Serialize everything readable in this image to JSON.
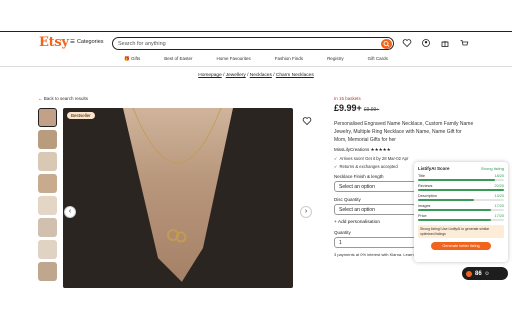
{
  "header": {
    "logo": "Etsy",
    "categories_label": "Categories",
    "search_placeholder": "Search for anything"
  },
  "nav": [
    "Gifts",
    "Best of Easter",
    "Home Favourites",
    "Fashion Finds",
    "Registry",
    "Gift Cards"
  ],
  "breadcrumb": [
    "Homepage",
    "Jewellery",
    "Necklaces",
    "Charm Necklaces"
  ],
  "back_link": "Back to search results",
  "main_image": {
    "badge": "Bestseller"
  },
  "listing": {
    "in_baskets": "In 15 baskets",
    "price": "£9.99+",
    "old_price": "£9.99+",
    "title": "Personalised Engraved Name Necklace, Custom Family Name Jewelry, Multiple Ring Necklace with Name, Name Gift for Mom, Memorial Gifts for her",
    "shop": "MissLilyCreations",
    "stars": "★★★★★",
    "arrives": "Arrives soon! Get it by 28 Mar-02 Apr",
    "returns": "Returns & exchanges accepted",
    "finish_label": "Necklace Finish & length",
    "finish_value": "Select an option",
    "disc_label": "Disc Quantity",
    "disc_value": "Select an option",
    "add_personalisation": "+ Add personalisation",
    "quantity_label": "Quantity",
    "quantity_value": "1",
    "klarna": "3 payments at 0% interest with Klarna. Learn more"
  },
  "panel": {
    "title": "ListifyAI Score",
    "level": "Strong listing",
    "metrics": [
      {
        "name": "Title",
        "score": "18/20",
        "fill": 0.9
      },
      {
        "name": "Reviews",
        "score": "20/20",
        "fill": 1.0
      },
      {
        "name": "Description",
        "score": "13/20",
        "fill": 0.65
      },
      {
        "name": "Images",
        "score": "17/20",
        "fill": 0.85
      },
      {
        "name": "Price",
        "score": "17/20",
        "fill": 0.85
      }
    ],
    "tip": "Strong listing! Use ListifyAI to generate similar optimised listings",
    "button": "Generate better listing"
  },
  "pill": {
    "score": "86"
  }
}
